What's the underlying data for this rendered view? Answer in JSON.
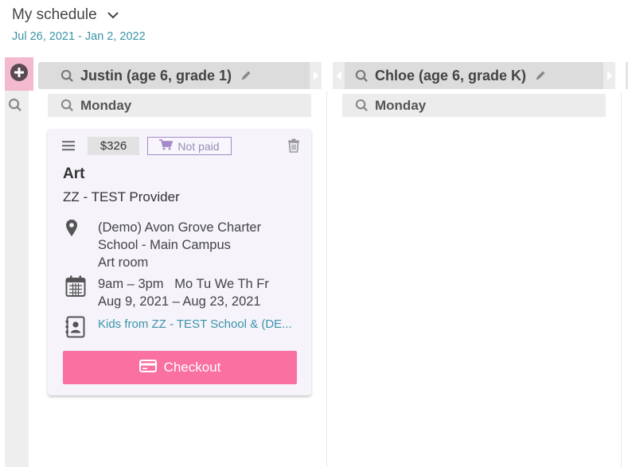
{
  "header": {
    "title": "My schedule",
    "date_range": "Jul 26, 2021 - Jan 2, 2022"
  },
  "columns": [
    {
      "kid_name": "Justin (age 6, grade 1)",
      "day": "Monday",
      "activity": {
        "price": "$326",
        "status": "Not paid",
        "title": "Art",
        "provider": "ZZ - TEST Provider",
        "location_line1": "(Demo) Avon Grove Charter",
        "location_line2": "School - Main Campus",
        "room": "Art room",
        "time_days": "9am – 3pm   Mo Tu We Th Fr",
        "dates": "Aug 9, 2021 – Aug 23, 2021",
        "audience": "Kids from ZZ - TEST School & (DE...",
        "checkout_label": "Checkout"
      }
    },
    {
      "kid_name": "Chloe (age 6, grade K)",
      "day": "Monday"
    }
  ],
  "colors": {
    "accent_pink": "#fa70a0",
    "add_button_bg": "#f2b9cf",
    "link_teal": "#3a94a8",
    "card_bg": "#f6f3fb",
    "not_paid_border": "#a58ac8"
  },
  "icons": [
    "chevron-down-icon",
    "plus-circle-icon",
    "search-icon",
    "pencil-icon",
    "chevron-right-icon",
    "chevron-left-icon",
    "menu-icon",
    "cart-icon",
    "trash-icon",
    "map-pin-icon",
    "calendar-icon",
    "contact-book-icon",
    "credit-card-icon"
  ]
}
